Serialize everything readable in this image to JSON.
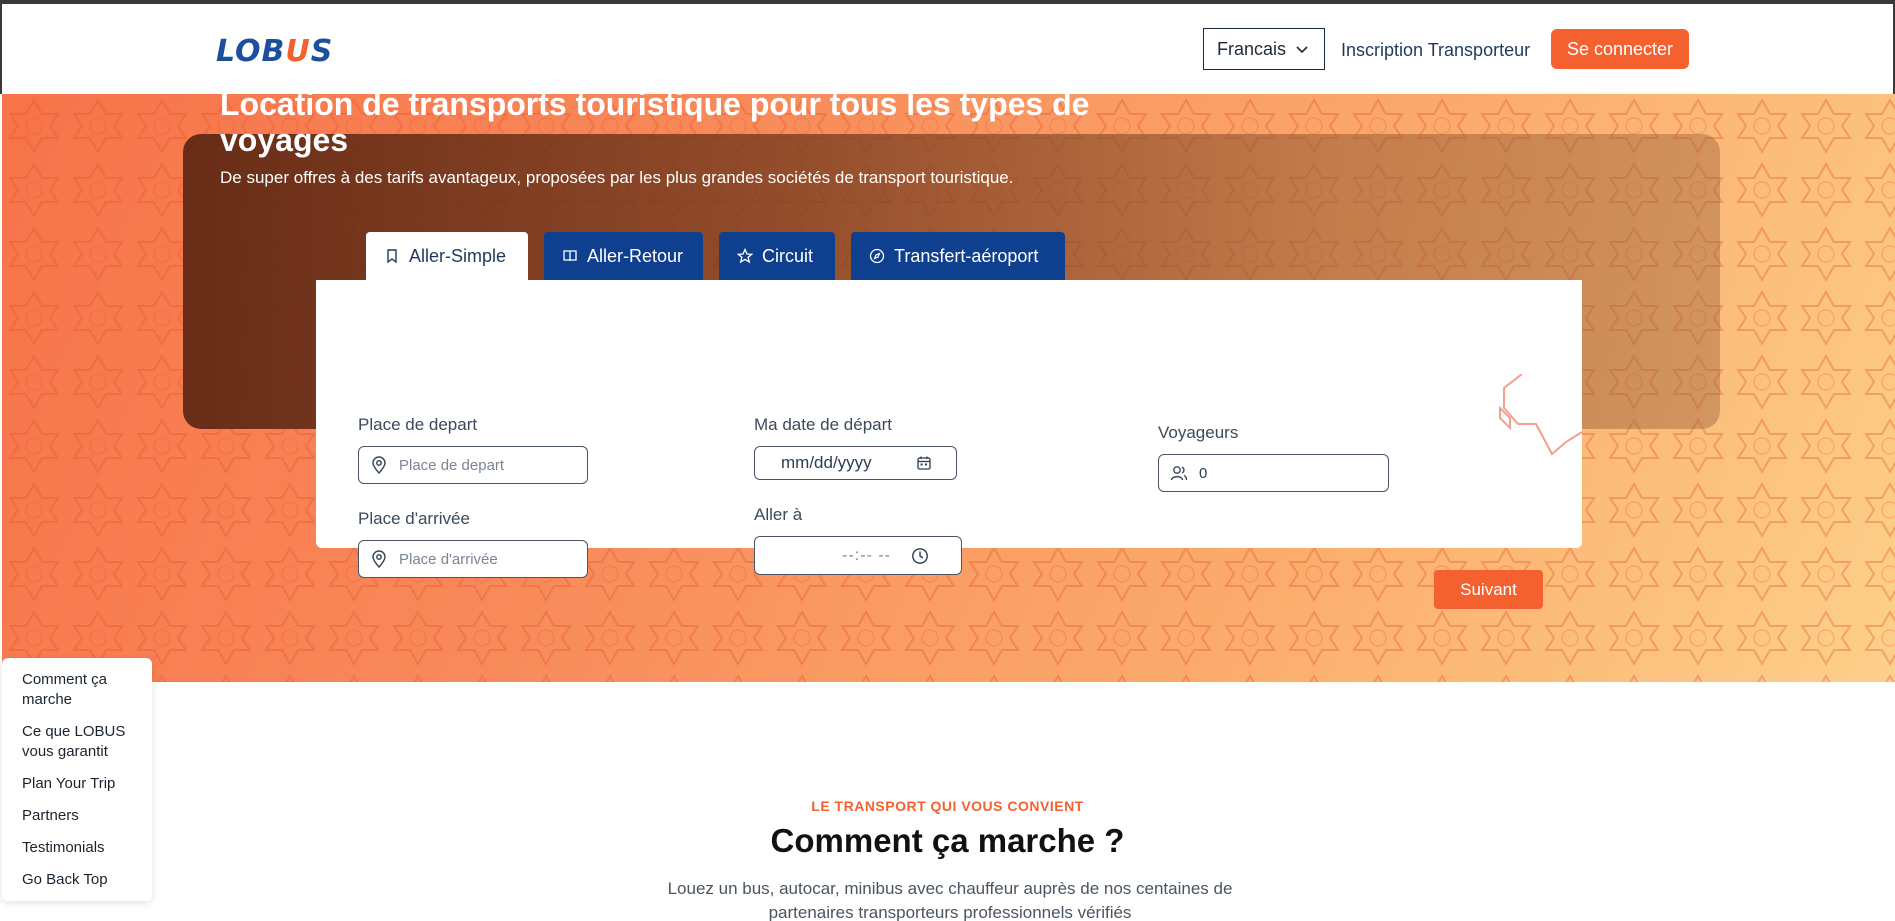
{
  "header": {
    "logo_text": "LOBUS",
    "language": "Francais",
    "signup_link": "Inscription Transporteur",
    "login_button": "Se connecter"
  },
  "hero": {
    "title": "Location de transports touristique pour tous les types de voyages",
    "subtitle": "De super offres à des tarifs avantageux, proposées par les plus grandes sociétés de transport touristique."
  },
  "tabs": [
    {
      "label": "Aller-Simple",
      "icon": "bookmark-icon",
      "active": true
    },
    {
      "label": "Aller-Retour",
      "icon": "book-icon",
      "active": false
    },
    {
      "label": "Circuit",
      "icon": "star-icon",
      "active": false
    },
    {
      "label": "Transfert-aéroport",
      "icon": "compass-icon",
      "active": false
    }
  ],
  "form": {
    "departure_label": "Place de depart",
    "departure_placeholder": "Place de depart",
    "arrival_label": "Place d'arrivée",
    "arrival_placeholder": "Place d'arrivée",
    "date_label": "Ma date de départ",
    "date_placeholder": "mm/dd/yyyy",
    "time_label": "Aller à",
    "time_placeholder": "--:-- --",
    "travelers_label": "Voyageurs",
    "travelers_value": "0",
    "next_button": "Suivant"
  },
  "side_nav": [
    "Comment ça marche",
    "Ce que LOBUS vous garantit",
    "Plan Your Trip",
    "Partners",
    "Testimonials",
    "Go Back Top"
  ],
  "section": {
    "eyebrow": "LE TRANSPORT QUI VOUS CONVIENT",
    "title": "Comment ça marche ?",
    "text": "Louez un bus, autocar, minibus avec chauffeur auprès de nos centaines de partenaires transporteurs professionnels vérifiés"
  },
  "colors": {
    "accent": "#f4612e",
    "brand_blue": "#0f3f8f"
  }
}
